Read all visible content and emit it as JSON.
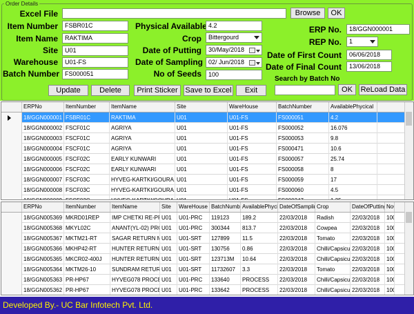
{
  "form": {
    "group_title": "Order Details",
    "excel_file_label": "Excel File",
    "excel_file_value": "",
    "browse_label": "Browse",
    "ok_label": "OK",
    "item_number_label": "Item Number",
    "item_number_value": "FSBR01C",
    "item_name_label": "Item Name",
    "item_name_value": "RAKTIMA",
    "site_label": "Site",
    "site_value": "U01",
    "warehouse_label": "Warehouse",
    "warehouse_value": "U01-FS",
    "batch_number_label": "Batch Number",
    "batch_number_value": "FS000051",
    "physical_available_label": "Physical Available",
    "physical_available_value": "4.2",
    "crop_label": "Crop",
    "crop_value": "Bittergourd",
    "date_putting_label": "Date of Putting",
    "date_putting_value": "30/May/2018",
    "date_sampling_label": "Date of Sampling",
    "date_sampling_value": "02/ Jun/2018",
    "no_seeds_label": "No of Seeds",
    "no_seeds_value": "100",
    "erp_no_label": "ERP No.",
    "erp_no_value": "18/GGN000001",
    "rep_no_label": "REP No.",
    "rep_no_value": "1",
    "first_count_label": "Date of First Count",
    "first_count_value": "06/06/2018",
    "final_count_label": "Date of Final Count",
    "final_count_value": "13/06/2018",
    "search_batch_label": "Search by Batch No",
    "search_batch_value": "",
    "search_ok_label": "OK",
    "reload_label": "ReLoad Data"
  },
  "buttons": {
    "update": "Update",
    "delete": "Delete",
    "print_sticker": "Print Sticker",
    "save_excel": "Save to Excel",
    "exit": "Exit"
  },
  "grid1": {
    "columns": [
      "ERPNo",
      "ItemNumber",
      "ItemName",
      "Site",
      "WareHouse",
      "BatchNumber",
      "AvailablePhycical"
    ],
    "rows": [
      [
        "18/GGN000001",
        "FSBR01C",
        "RAKTIMA",
        "U01",
        "U01-FS",
        "FS000051",
        "4.2"
      ],
      [
        "18/GGN000002",
        "FSCF01C",
        "AGRIYA",
        "U01",
        "U01-FS",
        "FS000052",
        "16.076"
      ],
      [
        "18/GGN000003",
        "FSCF01C",
        "AGRIYA",
        "U01",
        "U01-FS",
        "FS000053",
        "9.8"
      ],
      [
        "18/GGN000004",
        "FSCF01C",
        "AGRIYA",
        "U01",
        "U01-FS",
        "FS000471",
        "10.6"
      ],
      [
        "18/GGN000005",
        "FSCF02C",
        "EARLY KUNWARI",
        "U01",
        "U01-FS",
        "FS000057",
        "25.74"
      ],
      [
        "18/GGN000006",
        "FSCF02C",
        "EARLY KUNWARI",
        "U01",
        "U01-FS",
        "FS000058",
        "8"
      ],
      [
        "18/GGN000007",
        "FSCF03C",
        "HYVEG-KARTKI/GOURA...",
        "U01",
        "U01-FS",
        "FS000059",
        "17"
      ],
      [
        "18/GGN000008",
        "FSCF03C",
        "HYVEG-KARTKI/GOURA...",
        "U01",
        "U01-FS",
        "FS000060",
        "4.5"
      ],
      [
        "18/GGN000009",
        "FSCF03C",
        "HYVEG-KARTKI/GOURA...",
        "U01",
        "U01-FS",
        "FS000347",
        "1.35"
      ]
    ]
  },
  "grid2": {
    "columns": [
      "ERPNo",
      "ItemNumber",
      "ItemName",
      "Site",
      "WareHouse",
      "BatchNumbe",
      "AvailablePhycic",
      "DateOfSamplin",
      "Crop",
      "DateOfPutting",
      "NoO"
    ],
    "rows": [
      [
        "18/GGN005369",
        "MKRD01REP",
        "IMP CHETKI RE-PROC...",
        "U01",
        "U01-PRC",
        "119123",
        "189.2",
        "22/03/2018",
        "Radish",
        "22/03/2018",
        "100"
      ],
      [
        "18/GGN005368",
        "MKYL02C",
        "ANANT(YL-02) PROCE...",
        "U01",
        "U01-PRC",
        "300344",
        "813.7",
        "22/03/2018",
        "Cowpea",
        "22/03/2018",
        "100"
      ],
      [
        "18/GGN005367",
        "MKTM21-RT",
        "SAGAR RETURN M-27...",
        "U01",
        "U01-SRT",
        "127899",
        "11.5",
        "22/03/2018",
        "Tomato",
        "22/03/2018",
        "100"
      ],
      [
        "18/GGN005366",
        "MKHP42-RT",
        "HUNTER RETURN M-...",
        "U01",
        "U01-SRT",
        "130756",
        "0.86",
        "22/03/2018",
        "Chilli/Capsicum",
        "22/03/2018",
        "100"
      ],
      [
        "18/GGN005365",
        "MKCR02-400J",
        "HUNTER RETURN M-...",
        "U01",
        "U01-SRT",
        "123713M",
        "10.64",
        "22/03/2018",
        "Chilli/Capsicum",
        "22/03/2018",
        "100"
      ],
      [
        "18/GGN005364",
        "MKTM26-10",
        "SUNDRAM RETURN ...",
        "U01",
        "U01-SRT",
        "11732607",
        "3.3",
        "22/03/2018",
        "Tomato",
        "22/03/2018",
        "100"
      ],
      [
        "18/GGN005363",
        "PR-HP67",
        "HYVEG078 PROCESS ...",
        "U01",
        "U01-PRC",
        "133640",
        "PROCESS",
        "22/03/2018",
        "Chilli/Capsicum",
        "22/03/2018",
        "100"
      ],
      [
        "18/GGN005362",
        "PR-HP67",
        "HYVEG078 PROCESS ...",
        "U01",
        "U01-PRC",
        "133642",
        "PROCESS",
        "22/03/2018",
        "Chilli/Capsicum",
        "22/03/2018",
        "100"
      ]
    ]
  },
  "footer": {
    "text": "Developed By.- UC Bar Infotech Pvt. Ltd."
  },
  "colors": {
    "panel": "#8cf02a",
    "selected_row": "#3399ff",
    "footer_bg": "#2f1fa8",
    "footer_text": "#fff200"
  }
}
